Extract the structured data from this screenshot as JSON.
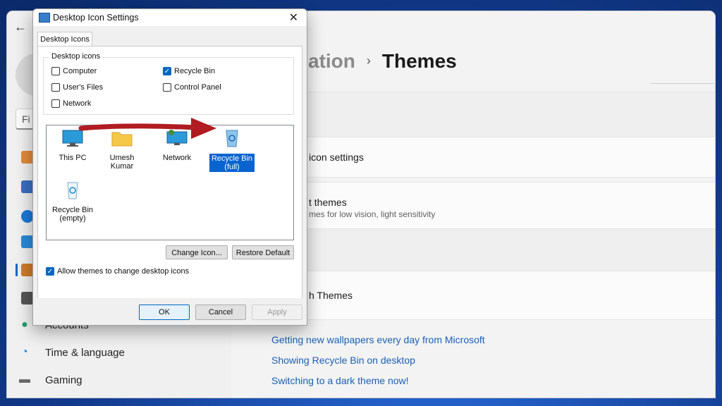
{
  "settings": {
    "find_placeholder": "Fi",
    "nav": [
      {
        "label": "Accounts",
        "icon": "person-icon"
      },
      {
        "label": "Time & language",
        "icon": "globe-clock-icon"
      },
      {
        "label": "Gaming",
        "icon": "gamepad-icon"
      }
    ],
    "breadcrumb_parent": "zation",
    "breadcrumb_sep": "›",
    "breadcrumb_current": "Themes",
    "cards": {
      "desktop_icon_settings": "icon settings",
      "contrast_title": "t themes",
      "contrast_sub": "mes for low vision, light sensitivity",
      "more_themes": "h Themes"
    },
    "links": [
      "Getting new wallpapers every day from Microsoft",
      "Showing Recycle Bin on desktop",
      "Switching to a dark theme now!"
    ]
  },
  "dialog": {
    "title": "Desktop Icon Settings",
    "close": "✕",
    "tab": "Desktop Icons",
    "group_label": "Desktop icons",
    "checkboxes": [
      {
        "label": "Computer",
        "checked": false
      },
      {
        "label": "User's Files",
        "checked": false
      },
      {
        "label": "Network",
        "checked": false
      },
      {
        "label": "Recycle Bin",
        "checked": true
      },
      {
        "label": "Control Panel",
        "checked": false
      }
    ],
    "icons": [
      {
        "label": "This PC"
      },
      {
        "label": "Umesh Kumar"
      },
      {
        "label": "Network"
      },
      {
        "label": "Recycle Bin (full)",
        "selected": true
      },
      {
        "label": "Recycle Bin (empty)"
      }
    ],
    "change_icon": "Change Icon...",
    "restore_default": "Restore Default",
    "allow_themes": "Allow themes to change desktop icons",
    "allow_themes_checked": true,
    "ok": "OK",
    "cancel": "Cancel",
    "apply": "Apply"
  },
  "colors": {
    "accent": "#0067c0",
    "arrow": "#b01c22",
    "link": "#1a5fb4"
  }
}
